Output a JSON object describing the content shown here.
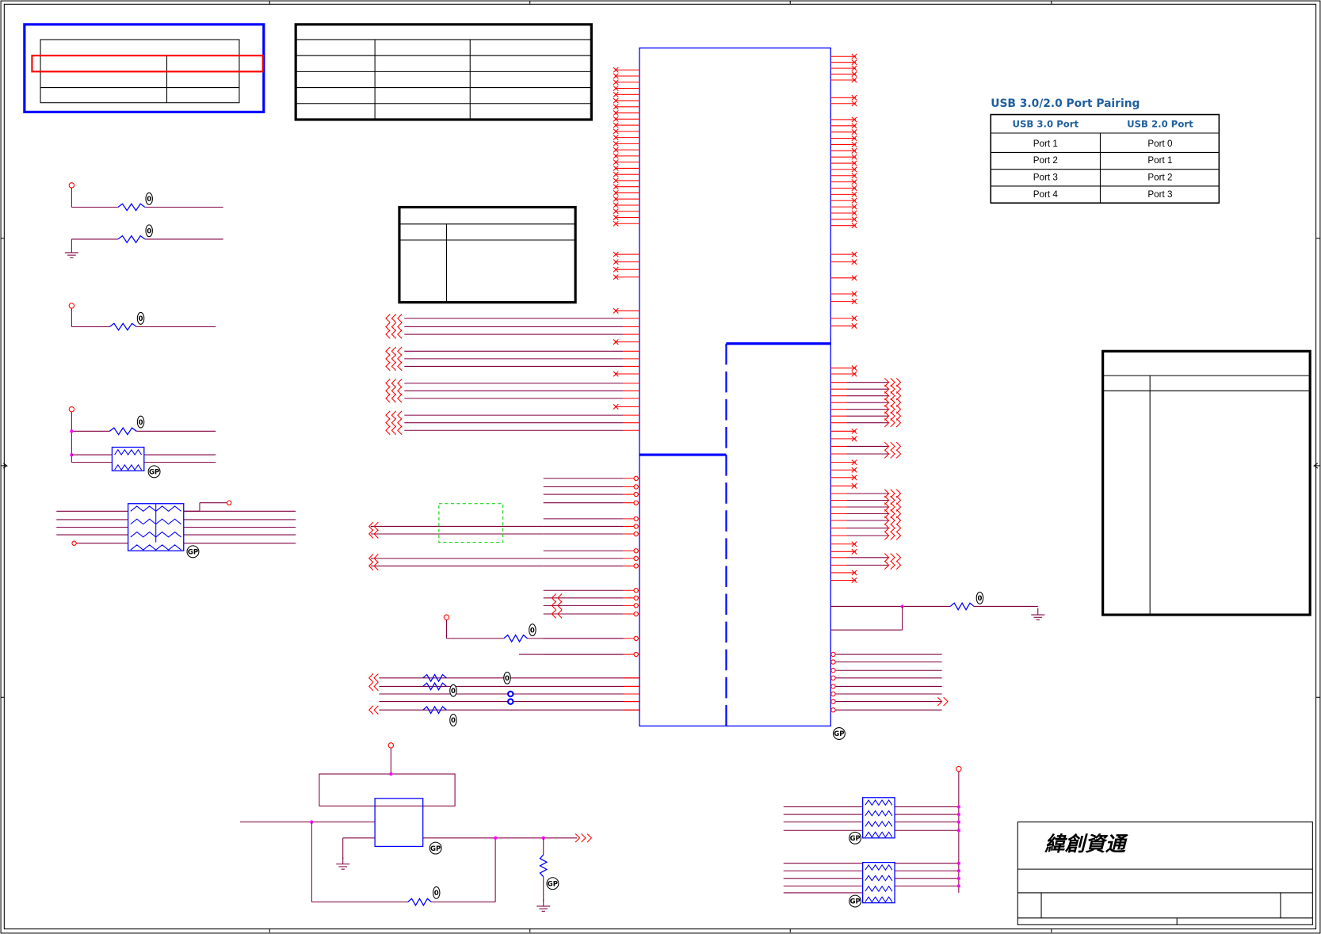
{
  "usb_table": {
    "title": "USB 3.0/2.0 Port Pairing",
    "headers": [
      "USB 3.0 Port",
      "USB 2.0 Port"
    ],
    "rows": [
      [
        "Port 1",
        "Port 0"
      ],
      [
        "Port 2",
        "Port 1"
      ],
      [
        "Port 3",
        "Port 2"
      ],
      [
        "Port 4",
        "Port 3"
      ]
    ]
  },
  "title_block": {
    "company_logo": "緯創資通"
  },
  "badges": {
    "zero": "0",
    "gp": "GP"
  },
  "colors": {
    "wire": "#800040",
    "pin": "#ff0000",
    "component": "#0000ff",
    "junction": "#ff00ff",
    "frame": "#000000",
    "highlight": "#ff0000",
    "dashed_box": "#00cc00"
  }
}
